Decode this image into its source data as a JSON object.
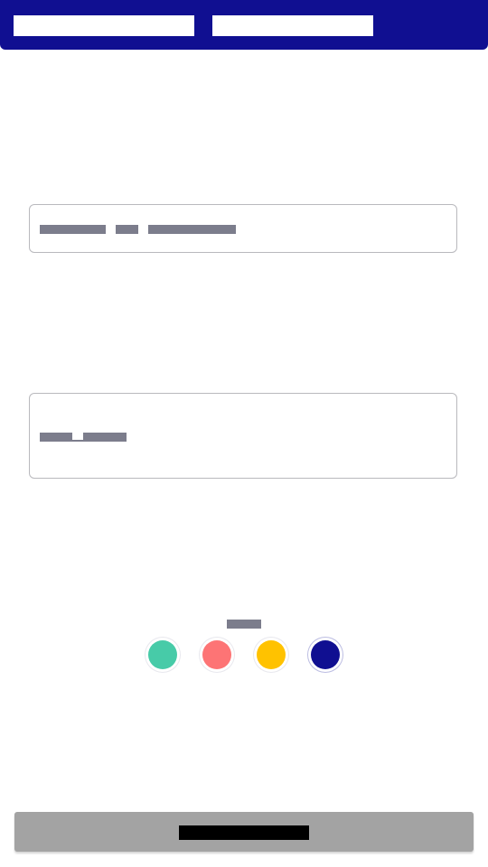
{
  "colors": {
    "header_bg": "#100f91",
    "field_border": "#b9b9bd",
    "placeholder_block": "#7c7d8c",
    "button_bg": "#a3a3a3",
    "button_label_block": "#000000"
  },
  "swatches": [
    {
      "name": "teal",
      "color": "#47cba8",
      "selected": false
    },
    {
      "name": "coral",
      "color": "#fd7475",
      "selected": false
    },
    {
      "name": "yellow",
      "color": "#ffc200",
      "selected": false
    },
    {
      "name": "navy",
      "color": "#100f91",
      "selected": true
    }
  ]
}
